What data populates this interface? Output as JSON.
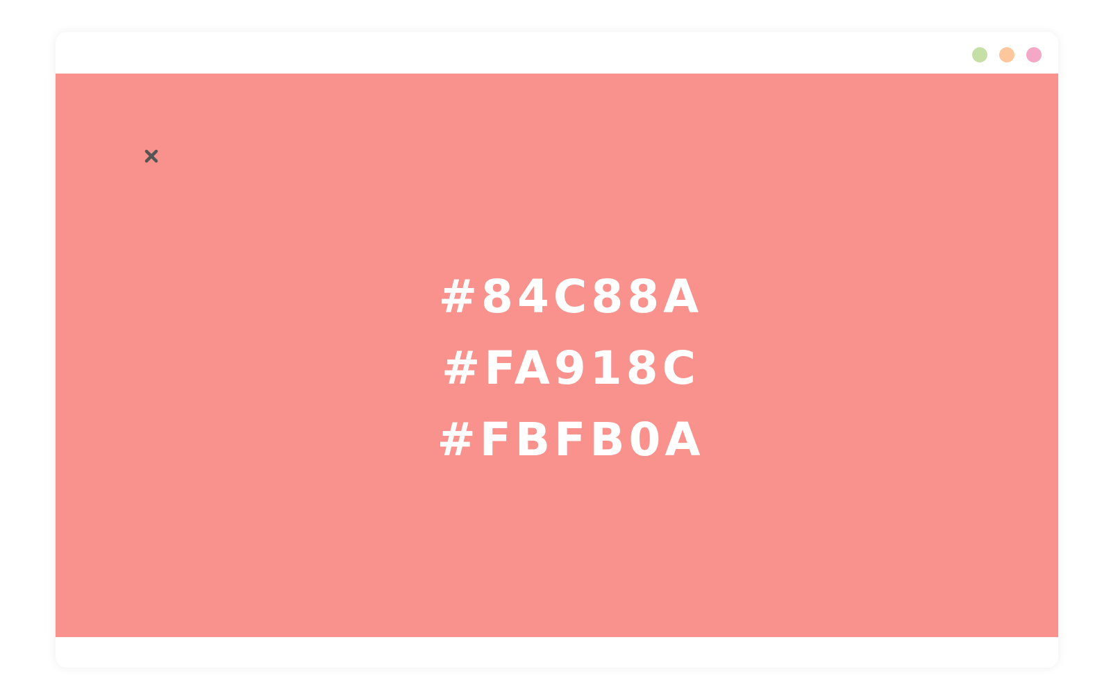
{
  "window": {
    "traffic_lights": [
      {
        "name": "green",
        "color": "#C6DFA6"
      },
      {
        "name": "orange",
        "color": "#FDC69C"
      },
      {
        "name": "pink",
        "color": "#F4A8C5"
      }
    ]
  },
  "content": {
    "background_color": "#F9918C",
    "close_icon": "close-icon",
    "close_icon_color": "#555555",
    "hex_codes": [
      "#84C88A",
      "#FA918C",
      "#FBFB0A"
    ]
  }
}
